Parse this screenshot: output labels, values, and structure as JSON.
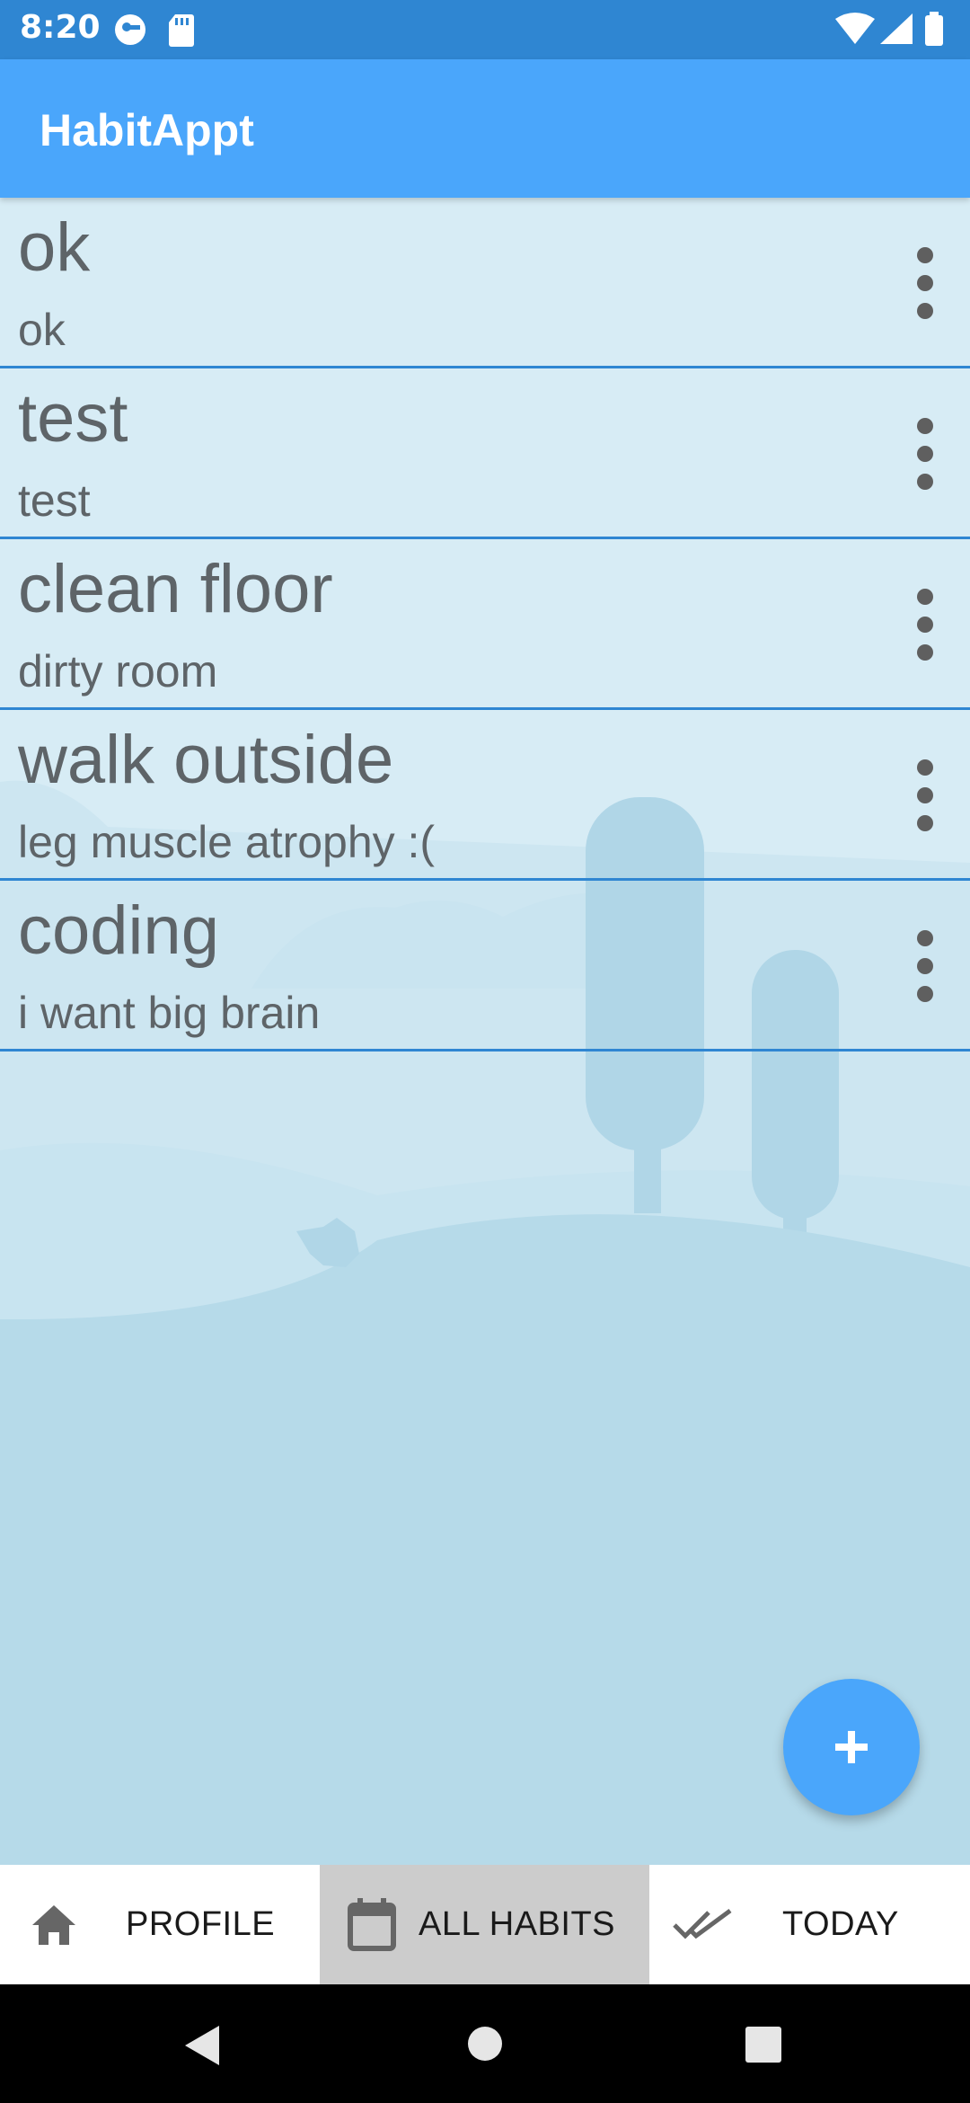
{
  "status_bar": {
    "time": "8:20",
    "left_icons": [
      "vpn-key-icon",
      "sd-card-icon"
    ],
    "right_icons": [
      "wifi-icon",
      "signal-icon",
      "battery-icon"
    ]
  },
  "app_bar": {
    "title": "HabitAppt"
  },
  "habits": [
    {
      "title": "ok",
      "description": "ok"
    },
    {
      "title": "test",
      "description": "test"
    },
    {
      "title": "clean floor",
      "description": "dirty room"
    },
    {
      "title": "walk outside",
      "description": "leg muscle atrophy :("
    },
    {
      "title": "coding",
      "description": "i want big brain"
    }
  ],
  "fab": {
    "icon": "plus-icon"
  },
  "bottom_nav": {
    "items": [
      {
        "label": "PROFILE",
        "icon": "home-icon",
        "active": false
      },
      {
        "label": "ALL HABITS",
        "icon": "calendar-icon",
        "active": true
      },
      {
        "label": "TODAY",
        "icon": "double-check-icon",
        "active": false
      }
    ]
  },
  "system_nav": [
    "back-icon",
    "home-circle-icon",
    "recents-icon"
  ],
  "colors": {
    "status_bar": "#2f86d2",
    "app_bar": "#4aa6fb",
    "divider": "#2f86d2",
    "fab": "#4aa6fb",
    "active_tab": "#cccccc"
  }
}
